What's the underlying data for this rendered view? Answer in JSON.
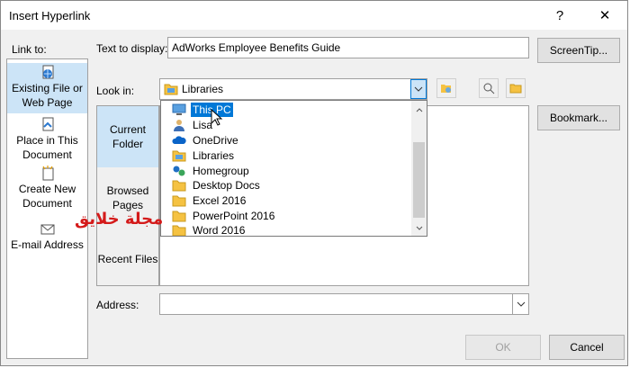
{
  "window": {
    "title": "Insert Hyperlink",
    "help_glyph": "?",
    "close_glyph": "✕"
  },
  "link_to": {
    "label": "Link to:",
    "items": [
      {
        "label_line1": "Existing File or",
        "label_line2": "Web Page",
        "icon": "globe-file-icon",
        "selected": true
      },
      {
        "label_line1": "Place in This",
        "label_line2": "Document",
        "icon": "document-place-icon",
        "selected": false
      },
      {
        "label_line1": "Create New",
        "label_line2": "Document",
        "icon": "new-document-icon",
        "selected": false
      },
      {
        "label_line1": "E-mail Address",
        "label_line2": "",
        "icon": "email-icon",
        "selected": false
      }
    ]
  },
  "text_to_display": {
    "label": "Text to display:",
    "value": "AdWorks Employee Benefits Guide"
  },
  "screentip_button": "ScreenTip...",
  "look_in": {
    "label": "Look in:",
    "value": "Libraries",
    "icon": "libraries-folder-icon"
  },
  "toolbar_icons": [
    "browse-web-icon",
    "browse-file-icon",
    "browse-folder-icon"
  ],
  "nav": {
    "current_folder": {
      "line1": "Current",
      "line2": "Folder"
    },
    "browsed_pages": {
      "line1": "Browsed",
      "line2": "Pages"
    },
    "recent_files": "Recent Files"
  },
  "dropdown_items": [
    {
      "label": "This PC",
      "icon": "this-pc-icon",
      "selected": true
    },
    {
      "label": "Lisa",
      "icon": "user-icon",
      "selected": false
    },
    {
      "label": "OneDrive",
      "icon": "onedrive-icon",
      "selected": false
    },
    {
      "label": "Libraries",
      "icon": "libraries-folder-icon",
      "selected": false
    },
    {
      "label": "Homegroup",
      "icon": "homegroup-icon",
      "selected": false
    },
    {
      "label": "Desktop Docs",
      "icon": "folder-icon",
      "selected": false
    },
    {
      "label": "Excel 2016",
      "icon": "folder-icon",
      "selected": false
    },
    {
      "label": "PowerPoint 2016",
      "icon": "folder-icon",
      "selected": false
    },
    {
      "label": "Word 2016",
      "icon": "folder-icon",
      "selected": false
    }
  ],
  "bookmark_button": "Bookmark...",
  "address": {
    "label": "Address:",
    "value": ""
  },
  "ok_button": "OK",
  "cancel_button": "Cancel",
  "watermark_text": "مجلة خلايق",
  "colors": {
    "selection_bg": "#0078d7",
    "link_selected_bg": "#cce4f7",
    "folder_yellow": "#f5c242",
    "watermark_red": "#d41a1a"
  }
}
